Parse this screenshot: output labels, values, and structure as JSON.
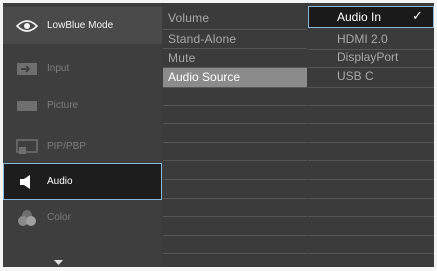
{
  "menu": {
    "items": [
      {
        "label": "LowBlue Mode",
        "icon": "eye-icon"
      },
      {
        "label": "Input",
        "icon": "input-icon"
      },
      {
        "label": "Picture",
        "icon": "picture-icon"
      },
      {
        "label": "PIP/PBP",
        "icon": "pip-icon"
      },
      {
        "label": "Audio",
        "icon": "speaker-icon"
      },
      {
        "label": "Color",
        "icon": "color-circles-icon"
      }
    ],
    "more_icon": "chevron-down-icon"
  },
  "audio_menu": {
    "items": [
      "Volume",
      "Stand-Alone",
      "Mute",
      "Audio Source"
    ],
    "selected": "Audio Source"
  },
  "source_menu": {
    "items": [
      "Audio In",
      "HDMI 2.0",
      "DisplayPort",
      "USB C"
    ],
    "selected": "Audio In",
    "check_glyph": "✓"
  },
  "colors": {
    "selection_outline": "#8bb8d8",
    "panel_background": "#3b3b3b",
    "highlight_bar": "#8b8b8b"
  }
}
